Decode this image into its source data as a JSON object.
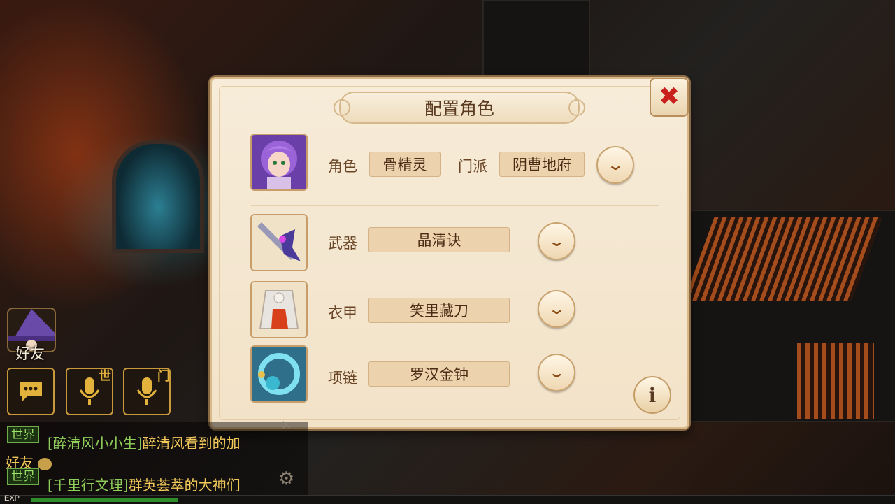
{
  "dialog": {
    "title": "配置角色",
    "character": {
      "label": "角色",
      "value": "骨精灵",
      "school_label": "门派",
      "school_value": "阴曹地府"
    },
    "equipment": [
      {
        "label": "武器",
        "value": "晶清诀",
        "icon": "weapon-icon"
      },
      {
        "label": "衣甲",
        "value": "笑里藏刀",
        "icon": "armor-icon"
      },
      {
        "label": "项链",
        "value": "罗汉金钟",
        "icon": "necklace-icon"
      }
    ],
    "info_symbol": "i",
    "close_symbol": "✖"
  },
  "hud": {
    "friend_label": "好友",
    "world_voice_tag": "世",
    "sect_voice_tag": "门"
  },
  "chat": {
    "messages": [
      {
        "channel": "世界",
        "sender": "[醉清风小小生]",
        "text": "醉清风看到的加",
        "text_cont": "好友"
      },
      {
        "channel": "世界",
        "sender": "[千里行文理]",
        "text": "群英荟萃的大神们"
      }
    ]
  },
  "exp": {
    "label": "EXP",
    "progress": 0.17
  },
  "colors": {
    "accent_red": "#c8201c",
    "panel_bg": "#f4e6cf",
    "label_brown": "#6a4626"
  }
}
